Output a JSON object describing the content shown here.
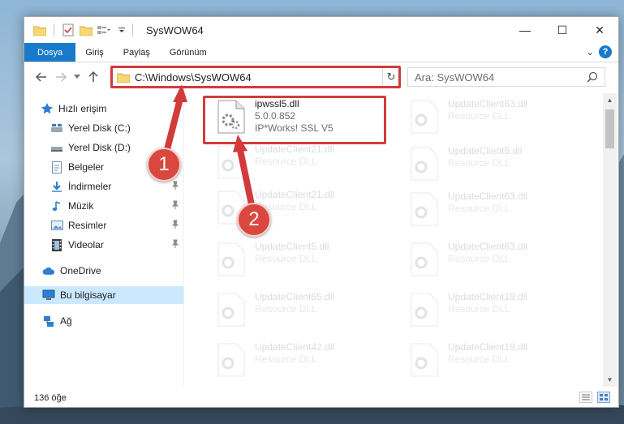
{
  "window": {
    "title": "SysWOW64",
    "minimize": "—",
    "maximize": "☐",
    "close": "✕"
  },
  "ribbon": {
    "tabs": [
      "Dosya",
      "Giriş",
      "Paylaş",
      "Görünüm"
    ],
    "help": "?",
    "expand": "⌄"
  },
  "address": {
    "path": "C:\\Windows\\SysWOW64",
    "refresh": "↻"
  },
  "search": {
    "placeholder": "Ara: SysWOW64"
  },
  "sidebar": {
    "items": [
      {
        "label": "Hızlı erişim",
        "icon": "star-icon",
        "pinned": false
      },
      {
        "label": "Yerel Disk (C:)",
        "icon": "drive-icon",
        "pinned": false
      },
      {
        "label": "Yerel Disk (D:)",
        "icon": "drive-icon",
        "pinned": false
      },
      {
        "label": "Belgeler",
        "icon": "document-icon",
        "pinned": true
      },
      {
        "label": "İndirmeler",
        "icon": "download-icon",
        "pinned": true
      },
      {
        "label": "Müzik",
        "icon": "music-icon",
        "pinned": true
      },
      {
        "label": "Resimler",
        "icon": "pictures-icon",
        "pinned": true
      },
      {
        "label": "Videolar",
        "icon": "video-icon",
        "pinned": true
      },
      {
        "label": "OneDrive",
        "icon": "cloud-icon",
        "pinned": false
      },
      {
        "label": "Bu bilgisayar",
        "icon": "computer-icon",
        "pinned": false
      },
      {
        "label": "Ağ",
        "icon": "network-icon",
        "pinned": false
      }
    ]
  },
  "files": {
    "featured": {
      "name": "ipwssl5.dll",
      "version": "5.0.0.852",
      "description": "IP*Works! SSL V5"
    },
    "left": [
      {
        "name": "UpdateClient21.dll",
        "type": "Resource DLL"
      },
      {
        "name": "UpdateClient21.dll",
        "type": "Resource DLL"
      },
      {
        "name": "UpdateClient5.dll",
        "type": "Resource DLL"
      },
      {
        "name": "UpdateClient65.dll",
        "type": "Resource DLL"
      },
      {
        "name": "UpdateClient42.dll",
        "type": "Resource DLL"
      }
    ],
    "right": [
      {
        "name": "UpdateClient63.dll",
        "type": "Resource DLL"
      },
      {
        "name": "UpdateClient5.dll",
        "type": "Resource DLL"
      },
      {
        "name": "UpdateClient63.dll",
        "type": "Resource DLL"
      },
      {
        "name": "UpdateClient63.dll",
        "type": "Resource DLL"
      },
      {
        "name": "UpdateClient19.dll",
        "type": "Resource DLL"
      },
      {
        "name": "UpdateClient19.dll",
        "type": "Resource DLL"
      }
    ]
  },
  "status": {
    "count": "136 öğe"
  },
  "callouts": {
    "one": "1",
    "two": "2",
    "color": "#d23b3b"
  }
}
